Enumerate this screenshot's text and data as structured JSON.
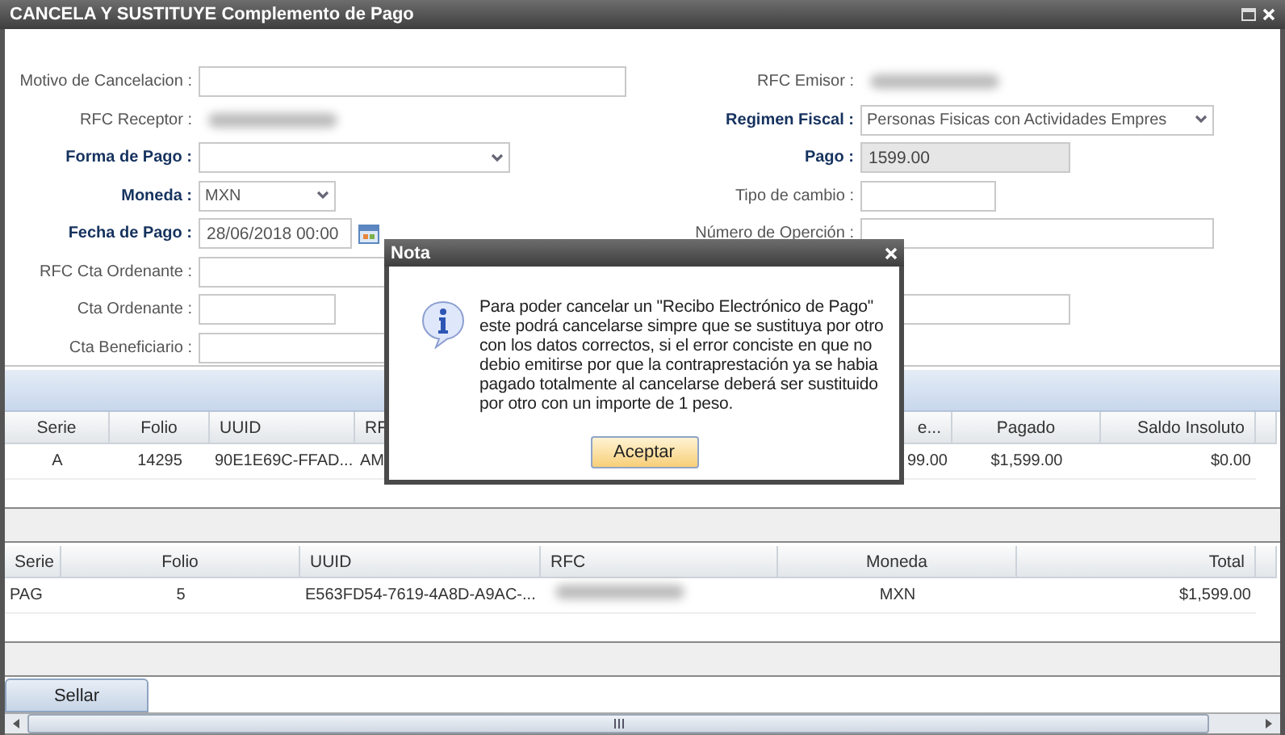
{
  "window": {
    "title": "CANCELA Y SUSTITUYE Complemento de Pago"
  },
  "form": {
    "left": [
      {
        "label": "Motivo de Cancelacion :",
        "required": false,
        "kind": "text"
      },
      {
        "label": "RFC Receptor :",
        "required": false,
        "kind": "blurred"
      },
      {
        "label": "Forma de Pago :",
        "required": true,
        "kind": "select"
      },
      {
        "label": "Moneda :",
        "required": true,
        "kind": "select",
        "value": "MXN"
      },
      {
        "label": "Fecha de Pago :",
        "required": true,
        "kind": "date",
        "value": "28/06/2018 00:00"
      },
      {
        "label": "RFC Cta Ordenante :",
        "required": false,
        "kind": "text"
      },
      {
        "label": "Cta Ordenante :",
        "required": false,
        "kind": "text"
      },
      {
        "label": "Cta Beneficiario :",
        "required": false,
        "kind": "text"
      }
    ],
    "right": [
      {
        "label": "RFC Emisor :",
        "required": false,
        "kind": "blurred"
      },
      {
        "label": "Regimen Fiscal :",
        "required": true,
        "kind": "select",
        "value": "Personas Fisicas con Actividades Empres"
      },
      {
        "label": "Pago :",
        "required": true,
        "kind": "text",
        "value": "1599.00",
        "disabled": true
      },
      {
        "label": "Tipo de cambio :",
        "required": false,
        "kind": "text"
      },
      {
        "label": "Número de Operción :",
        "required": false,
        "kind": "text"
      },
      {
        "kind": "text"
      }
    ]
  },
  "tables": [
    {
      "columns": [
        "Serie",
        "Folio",
        "UUID",
        "RF",
        "e...",
        "Pagado",
        "Saldo Insoluto"
      ],
      "rows": [
        [
          "A",
          "14295",
          "90E1E69C-FFAD...",
          "AM",
          "99.00",
          "$1,599.00",
          "$0.00"
        ]
      ]
    },
    {
      "columns": [
        "Serie",
        "Folio",
        "UUID",
        "RFC",
        "Moneda",
        "Total"
      ],
      "rows": [
        [
          "PAG",
          "5",
          "E563FD54-7619-4A8D-A9AC-...",
          {
            "kind": "blurred"
          },
          "MXN",
          "$1,599.00"
        ]
      ]
    }
  ],
  "buttons": [
    "Sellar"
  ],
  "dialog": {
    "title": "Nota",
    "message": "Para poder cancelar un \"Recibo Electrónico de Pago\" este podrá cancelarse simpre que se sustituya por otro con los datos correctos, si el error conciste en que no debio emitirse por que la contraprestación ya se habia pagado totalmente al cancelarse deberá ser sustituido por otro con un importe de 1 peso.",
    "button": "Aceptar"
  }
}
